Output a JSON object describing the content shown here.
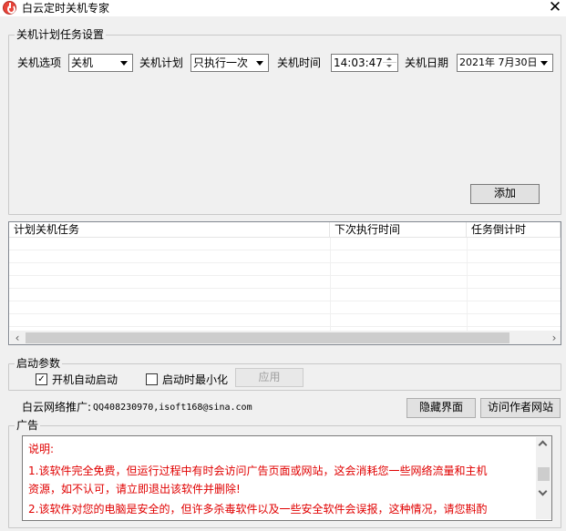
{
  "window": {
    "title": "白云定时关机专家",
    "close_glyph": "✕"
  },
  "schedule_group": {
    "title": "关机计划任务设置",
    "option_label": "关机选项",
    "option_value": "关机",
    "plan_label": "关机计划",
    "plan_value": "只执行一次",
    "time_label": "关机时间",
    "time_value": "14:03:47",
    "date_label": "关机日期",
    "date_value": "2021年 7月30日",
    "add_button": "添加"
  },
  "task_list": {
    "columns": [
      "计划关机任务",
      "下次执行时间",
      "任务倒计时"
    ],
    "rows": [],
    "scroll_left": "‹",
    "scroll_right": "›"
  },
  "startup_group": {
    "title": "启动参数",
    "auto_start_label": "开机自动启动",
    "auto_start_checked": true,
    "minimize_label": "启动时最小化",
    "minimize_checked": false,
    "apply_button": "应用"
  },
  "promo": {
    "label": "白云网络推广:",
    "contact": "QQ408230970,isoft168@sina.com",
    "hide_button": "隐藏界面",
    "visit_button": "访问作者网站"
  },
  "ad_group": {
    "title": "广告",
    "lines": [
      "说明:",
      "1.该软件完全免费，但运行过程中有时会访问广告页面或网站，这会消耗您一些网络流量和主机",
      "资源，如不认可，请立即退出该软件并删除!",
      "2.该软件对您的电脑是安全的，但许多杀毒软件以及一些安全软件会误报，这种情况，请您斟酌"
    ]
  },
  "colors": {
    "ad_text": "#e00000",
    "background": "#f0f0f0"
  }
}
